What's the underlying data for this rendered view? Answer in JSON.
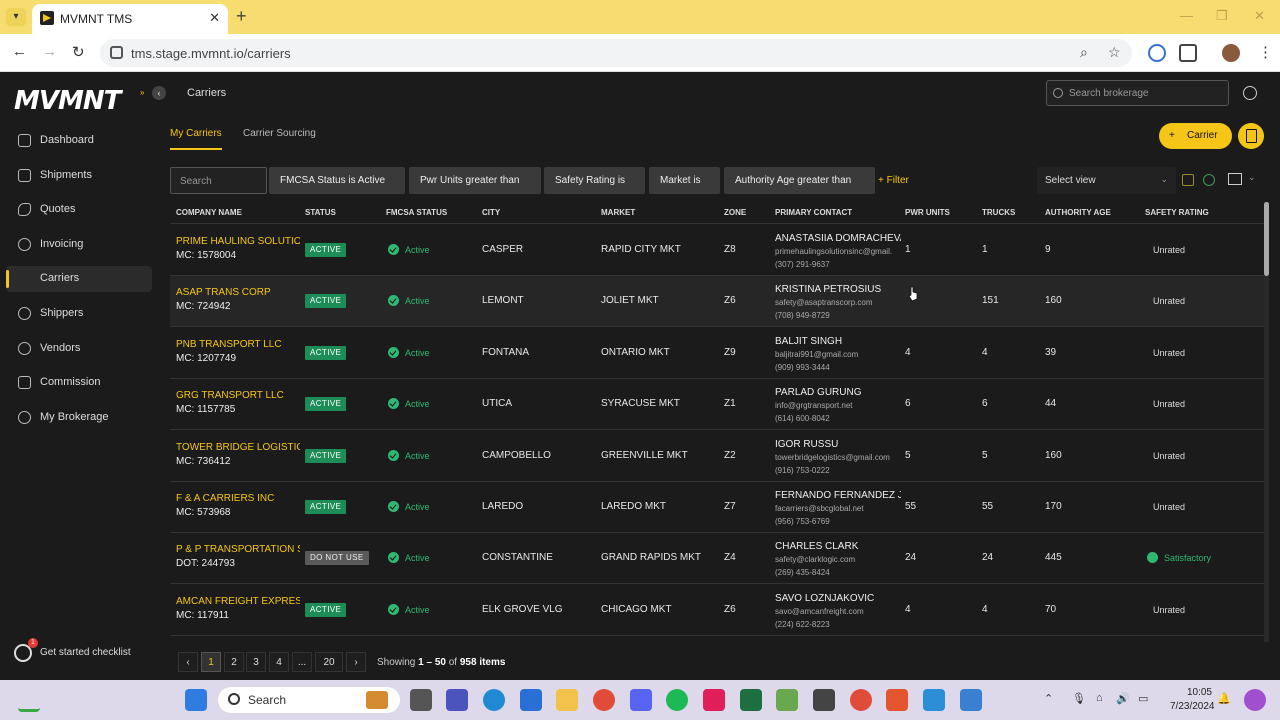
{
  "browser": {
    "tab_title": "MVMNT TMS",
    "url": "tms.stage.mvmnt.io/carriers"
  },
  "app": {
    "logo": "MVMNT",
    "breadcrumb": "Carriers",
    "brokerage_search_placeholder": "Search brokerage",
    "checklist_label": "Get started checklist",
    "checklist_badge": "1"
  },
  "sidebar": {
    "items": [
      {
        "label": "Dashboard",
        "icon": "dashboard-icon"
      },
      {
        "label": "Shipments",
        "icon": "box-icon"
      },
      {
        "label": "Quotes",
        "icon": "tag-icon"
      },
      {
        "label": "Invoicing",
        "icon": "dollar-icon"
      },
      {
        "label": "Carriers",
        "icon": "truck-icon",
        "active": true
      },
      {
        "label": "Shippers",
        "icon": "people-icon"
      },
      {
        "label": "Vendors",
        "icon": "vendor-icon"
      },
      {
        "label": "Commission",
        "icon": "commission-icon"
      },
      {
        "label": "My Brokerage",
        "icon": "globe-icon"
      }
    ]
  },
  "page_tabs": [
    "My Carriers",
    "Carrier Sourcing"
  ],
  "actions": {
    "add_carrier": "Carrier"
  },
  "filters": {
    "search_placeholder": "Search",
    "chips": [
      "FMCSA Status is Active",
      "Pwr Units greater than",
      "Safety Rating is",
      "Market is",
      "Authority Age greater than"
    ],
    "add_filter": "Filter",
    "select_view": "Select view"
  },
  "table": {
    "columns": [
      "COMPANY NAME",
      "STATUS",
      "FMCSA STATUS",
      "CITY",
      "MARKET",
      "ZONE",
      "PRIMARY CONTACT",
      "PWR UNITS",
      "TRUCKS",
      "AUTHORITY AGE",
      "SAFETY RATING"
    ],
    "rows": [
      {
        "name": "PRIME HAULING SOLUTION",
        "id": "MC: 1578004",
        "status": "ACTIVE",
        "fmcsa": "Active",
        "city": "CASPER",
        "market": "RAPID CITY MKT",
        "zone": "Z8",
        "contact": "ANASTASIIA DOMRACHEVA",
        "email": "primehaulingsolutionsinc@gmail.",
        "phone": "(307) 291-9637",
        "pwr": "1",
        "trucks": "1",
        "age": "9",
        "safety": "Unrated"
      },
      {
        "name": "ASAP TRANS CORP",
        "id": "MC: 724942",
        "status": "ACTIVE",
        "fmcsa": "Active",
        "city": "LEMONT",
        "market": "JOLIET MKT",
        "zone": "Z6",
        "contact": "KRISTINA PETROSIUS",
        "email": "safety@asaptranscorp.com",
        "phone": "(708) 949-8729",
        "pwr": "",
        "trucks": "151",
        "age": "160",
        "safety": "Unrated"
      },
      {
        "name": "PNB TRANSPORT LLC",
        "id": "MC: 1207749",
        "status": "ACTIVE",
        "fmcsa": "Active",
        "city": "FONTANA",
        "market": "ONTARIO MKT",
        "zone": "Z9",
        "contact": "BALJIT SINGH",
        "email": "baljitrai991@gmail.com",
        "phone": "(909) 993-3444",
        "pwr": "4",
        "trucks": "4",
        "age": "39",
        "safety": "Unrated"
      },
      {
        "name": "GRG TRANSPORT LLC",
        "id": "MC: 1157785",
        "status": "ACTIVE",
        "fmcsa": "Active",
        "city": "UTICA",
        "market": "SYRACUSE MKT",
        "zone": "Z1",
        "contact": "PARLAD GURUNG",
        "email": "info@grgtransport.net",
        "phone": "(614) 600-8042",
        "pwr": "6",
        "trucks": "6",
        "age": "44",
        "safety": "Unrated"
      },
      {
        "name": "TOWER BRIDGE LOGISTICS",
        "id": "MC: 736412",
        "status": "ACTIVE",
        "fmcsa": "Active",
        "city": "CAMPOBELLO",
        "market": "GREENVILLE MKT",
        "zone": "Z2",
        "contact": "IGOR RUSSU",
        "email": "towerbridgelogistics@gmail.com",
        "phone": "(916) 753-0222",
        "pwr": "5",
        "trucks": "5",
        "age": "160",
        "safety": "Unrated"
      },
      {
        "name": "F & A CARRIERS INC",
        "id": "MC: 573968",
        "status": "ACTIVE",
        "fmcsa": "Active",
        "city": "LAREDO",
        "market": "LAREDO MKT",
        "zone": "Z7",
        "contact": "FERNANDO FERNANDEZ JR",
        "email": "facarriers@sbcglobal.net",
        "phone": "(956) 753-6769",
        "pwr": "55",
        "trucks": "55",
        "age": "170",
        "safety": "Unrated"
      },
      {
        "name": "P & P TRANSPORTATION SE",
        "id": "DOT: 244793",
        "status": "DO NOT USE",
        "fmcsa": "Active",
        "city": "CONSTANTINE",
        "market": "GRAND RAPIDS MKT",
        "zone": "Z4",
        "contact": "CHARLES CLARK",
        "email": "safety@clarklogic.com",
        "phone": "(269) 435-8424",
        "pwr": "24",
        "trucks": "24",
        "age": "445",
        "safety": "Satisfactory"
      },
      {
        "name": "AMCAN FREIGHT EXPRESS I",
        "id": "MC: 117911",
        "status": "ACTIVE",
        "fmcsa": "Active",
        "city": "ELK GROVE VLG",
        "market": "CHICAGO MKT",
        "zone": "Z6",
        "contact": "SAVO LOZNJAKOVIC",
        "email": "savo@amcanfreight.com",
        "phone": "(224) 622-8223",
        "pwr": "4",
        "trucks": "4",
        "age": "70",
        "safety": "Unrated"
      }
    ]
  },
  "pagination": {
    "pages": [
      "1",
      "2",
      "3",
      "4",
      "...",
      "20"
    ],
    "current": "1",
    "showing_prefix": "Showing",
    "range": "1 – 50",
    "of": "of",
    "total": "958 items"
  },
  "taskbar": {
    "search_label": "Search",
    "time": "10:05",
    "date": "7/23/2024"
  },
  "colors": {
    "accent": "#f5c518",
    "active_green": "#1e8c57",
    "fmcsa_green": "#2eb872"
  }
}
